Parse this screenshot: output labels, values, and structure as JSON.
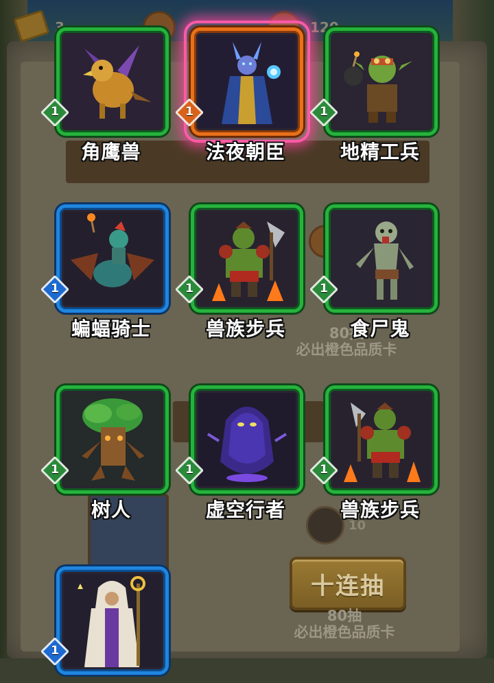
{
  "background": {
    "top_counter_left": "3",
    "top_counter_right": "120",
    "mid_note_count": "80抽",
    "mid_note_text": "必出橙色品质卡",
    "bottom_small_count": "10",
    "ten_draw_label": "十连抽",
    "bottom_note_count": "80抽",
    "bottom_note_text": "必出橙色品质卡"
  },
  "cards": [
    {
      "name": "角鹰兽",
      "level": "1",
      "rarity": "green",
      "icon": "griffin-icon"
    },
    {
      "name": "法夜朝臣",
      "level": "1",
      "rarity": "orange",
      "icon": "nightborne-courtier-icon",
      "highlighted": true
    },
    {
      "name": "地精工兵",
      "level": "1",
      "rarity": "green",
      "icon": "goblin-sapper-icon"
    },
    {
      "name": "蝙蝠骑士",
      "level": "1",
      "rarity": "blue",
      "icon": "bat-rider-icon"
    },
    {
      "name": "兽族步兵",
      "level": "1",
      "rarity": "green",
      "icon": "orc-grunt-icon"
    },
    {
      "name": "食尸鬼",
      "level": "1",
      "rarity": "green",
      "icon": "ghoul-icon"
    },
    {
      "name": "树人",
      "level": "1",
      "rarity": "green",
      "icon": "treant-icon"
    },
    {
      "name": "虚空行者",
      "level": "1",
      "rarity": "green",
      "icon": "voidwalker-icon"
    },
    {
      "name": "兽族步兵",
      "level": "1",
      "rarity": "green",
      "icon": "orc-grunt-icon"
    },
    {
      "name": "",
      "level": "1",
      "rarity": "blue",
      "icon": "priest-icon"
    }
  ],
  "colors": {
    "green": "#25b33c",
    "blue": "#1f86e0",
    "orange": "#e8711a",
    "highlight": "#ff5aa6"
  }
}
